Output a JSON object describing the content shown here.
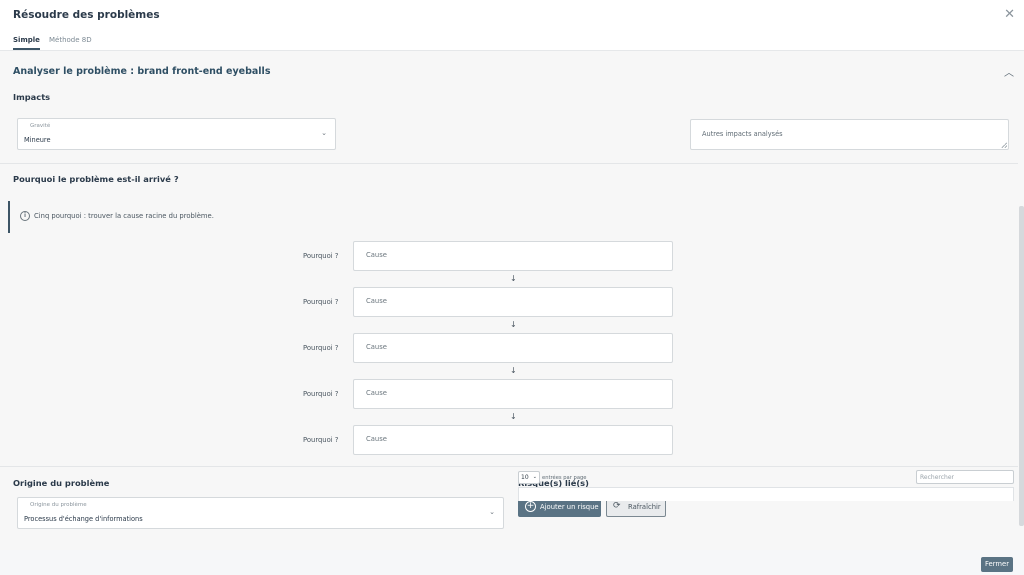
{
  "dialog": {
    "title": "Résoudre des problèmes"
  },
  "tabs": [
    {
      "label": "Simple",
      "active": true
    },
    {
      "label": "Méthode 8D",
      "active": false
    }
  ],
  "analysis": {
    "section_title": "Analyser le problème : brand front-end eyeballs",
    "impacts_title": "Impacts",
    "severity": {
      "label": "Gravité",
      "value": "Mineure"
    },
    "other_impacts_placeholder": "Autres impacts analysés"
  },
  "why": {
    "title": "Pourquoi le problème est-il arrivé ?",
    "info": "Cinq pourquoi : trouver la cause racine du problème.",
    "rows": [
      {
        "label": "Pourquoi ?",
        "placeholder": "Cause"
      },
      {
        "label": "Pourquoi ?",
        "placeholder": "Cause"
      },
      {
        "label": "Pourquoi ?",
        "placeholder": "Cause"
      },
      {
        "label": "Pourquoi ?",
        "placeholder": "Cause"
      },
      {
        "label": "Pourquoi ?",
        "placeholder": "Cause"
      }
    ],
    "arrow": "↓"
  },
  "origin": {
    "title": "Origine du problème",
    "field_label": "Origine du problème",
    "value": "Processus d'échange d'informations"
  },
  "risks": {
    "title": "Risque(s) lié(s)",
    "add_button": "Ajouter un risque",
    "refresh_button": "Rafraîchir",
    "page_size": "10",
    "page_size_label": "entrées par page",
    "search_placeholder": "Rechercher"
  },
  "footer": {
    "close_button": "Fermer"
  },
  "colors": {
    "accent": "#5a7384",
    "title": "#2f4f64",
    "background": "#f7f7f7"
  },
  "icons": [
    "close-icon",
    "chevron-up-icon",
    "chevron-down-icon",
    "info-icon",
    "plus-circle-icon",
    "refresh-icon"
  ]
}
